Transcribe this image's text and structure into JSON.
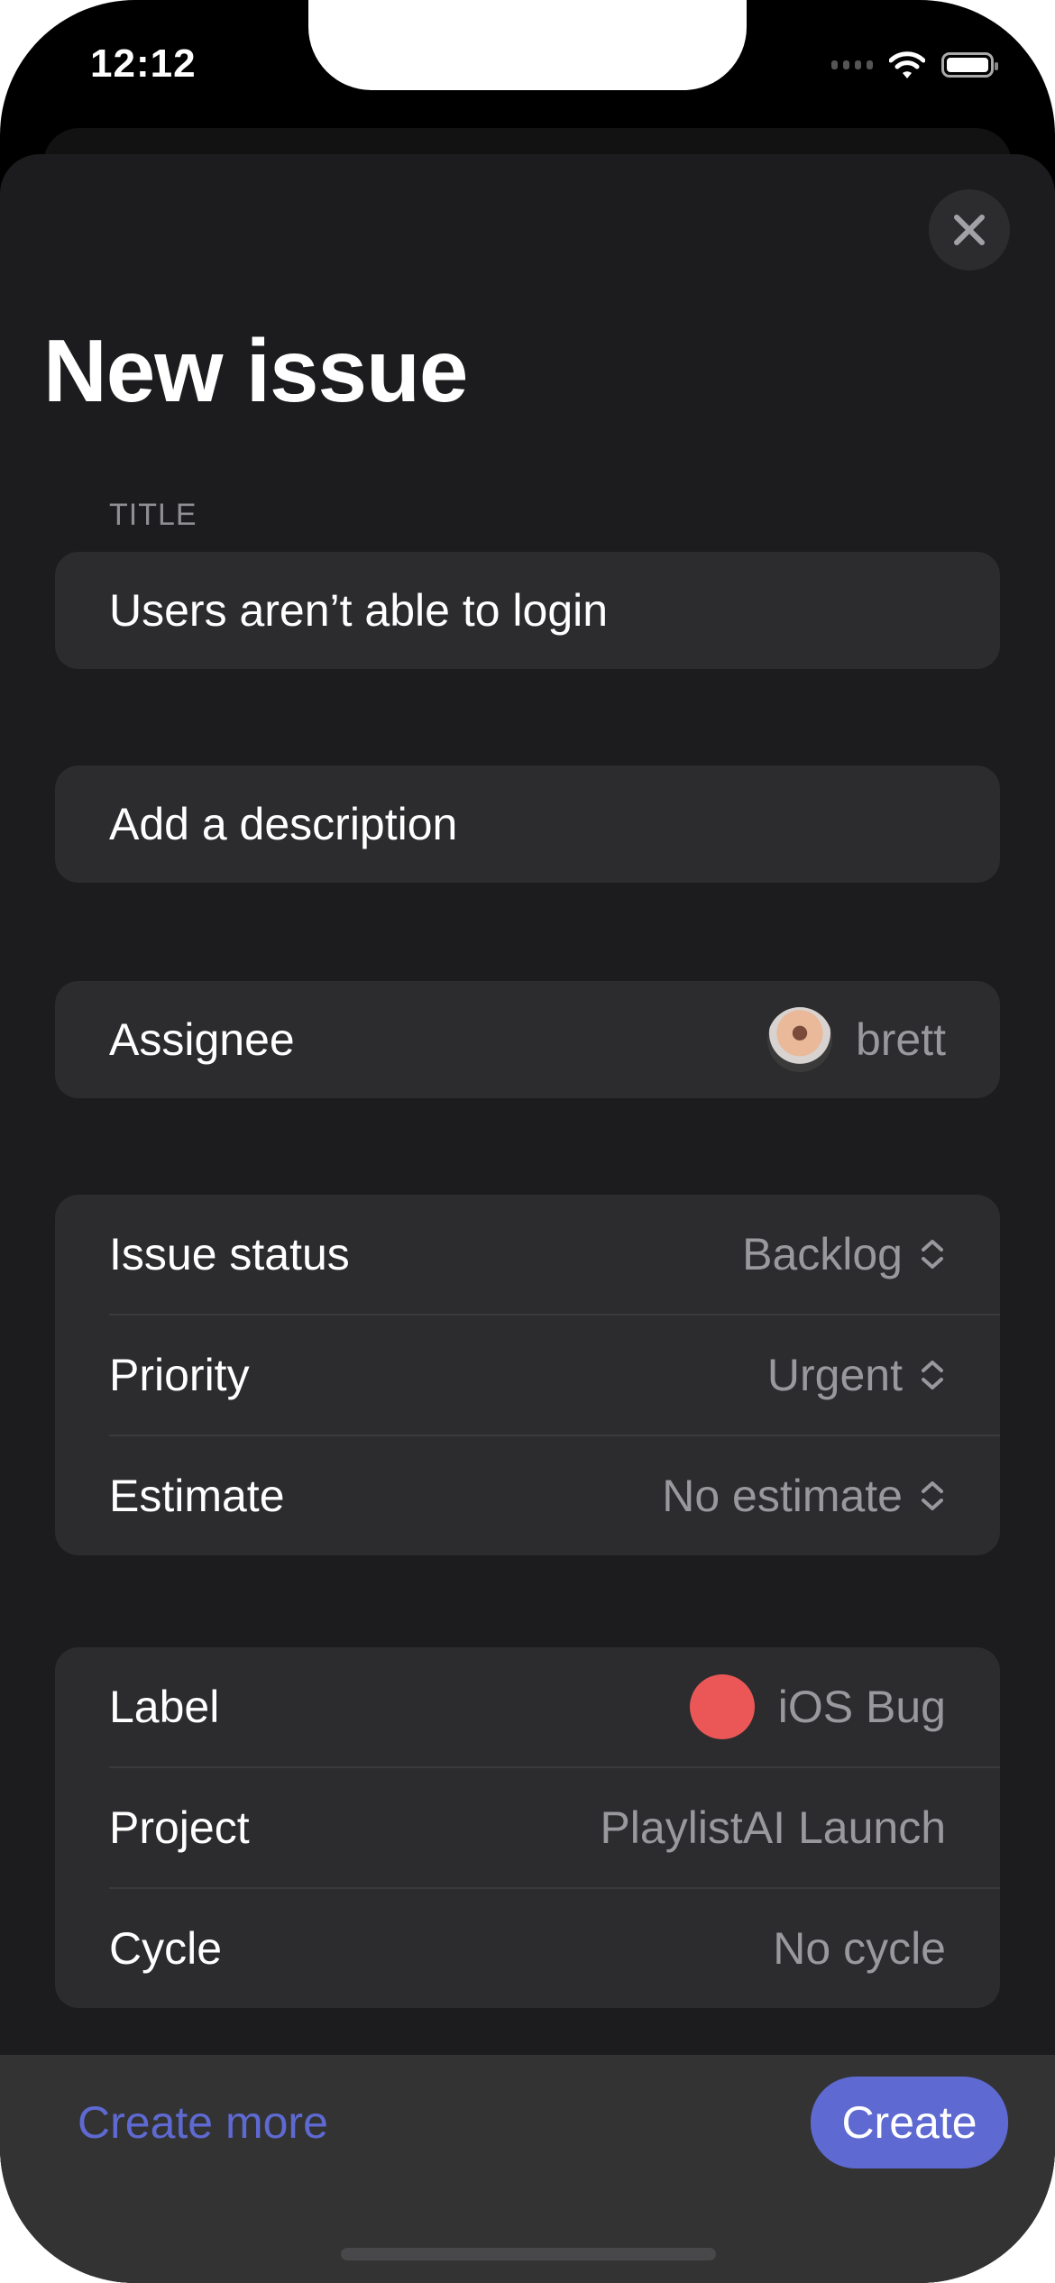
{
  "status_bar": {
    "time": "12:12"
  },
  "header": {
    "title": "New issue",
    "close_icon": "xmark-icon"
  },
  "form": {
    "title_label": "TITLE",
    "title_value": "Users aren’t able to login",
    "description_placeholder": "Add a description",
    "assignee": {
      "label": "Assignee",
      "value": "brett"
    },
    "group1": [
      {
        "label": "Issue status",
        "value": "Backlog",
        "icon": "chevron-up-down-icon"
      },
      {
        "label": "Priority",
        "value": "Urgent",
        "icon": "chevron-up-down-icon"
      },
      {
        "label": "Estimate",
        "value": "No estimate",
        "icon": "chevron-up-down-icon"
      }
    ],
    "group2": [
      {
        "label": "Label",
        "value": "iOS Bug",
        "color": "#EB5757"
      },
      {
        "label": "Project",
        "value": "PlaylistAI Launch"
      },
      {
        "label": "Cycle",
        "value": "No cycle"
      }
    ]
  },
  "footer": {
    "create_more": "Create more",
    "create": "Create",
    "accent": "#5E6AD2"
  }
}
